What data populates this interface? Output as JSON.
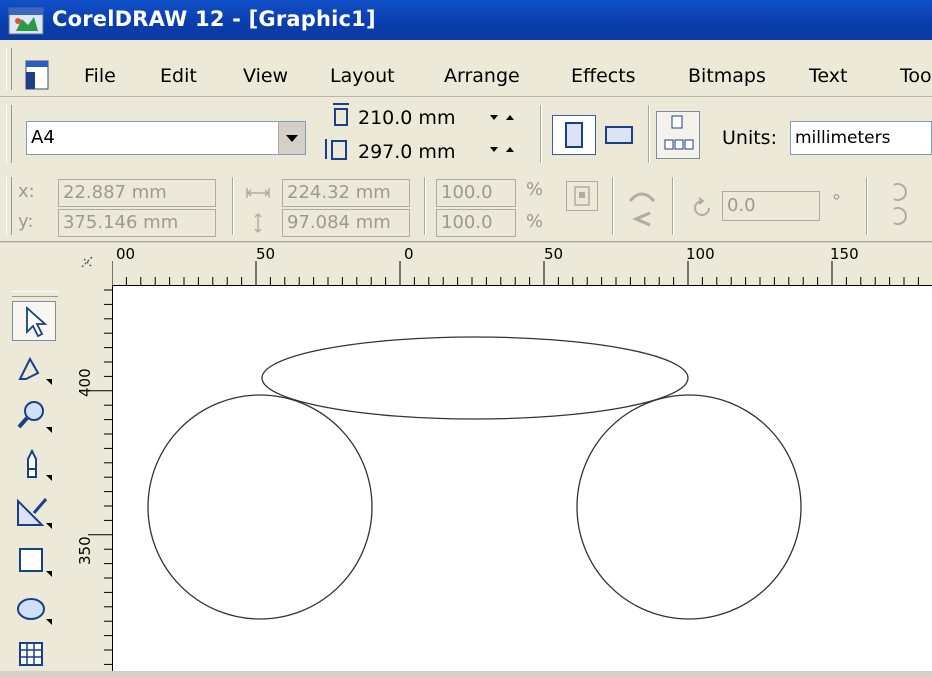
{
  "window": {
    "title": "CorelDRAW 12 - [Graphic1]"
  },
  "menu": [
    "File",
    "Edit",
    "View",
    "Layout",
    "Arrange",
    "Effects",
    "Bitmaps",
    "Text",
    "Tools"
  ],
  "property_bar": {
    "paper_size": "A4",
    "width": "210.0 mm",
    "height": "297.0 mm",
    "units_label": "Units:",
    "units_value": "millimeters"
  },
  "object_bar": {
    "x_label": "x:",
    "y_label": "y:",
    "x": "22.887 mm",
    "y": "375.146 mm",
    "obj_width": "224.32 mm",
    "obj_height": "97.084 mm",
    "scale_x": "100.0",
    "scale_y": "100.0",
    "percent": "%",
    "rotation": "0.0",
    "degree": "°"
  },
  "rulers": {
    "horizontal_labels": [
      "00",
      "50",
      "0",
      "50",
      "100",
      "150"
    ],
    "vertical_labels": [
      "400",
      "350"
    ]
  },
  "toolbox": [
    "pick-tool",
    "shape-tool",
    "zoom-tool",
    "freehand-tool",
    "smart-fill-tool",
    "rectangle-tool",
    "ellipse-tool",
    "graph-paper-tool"
  ]
}
